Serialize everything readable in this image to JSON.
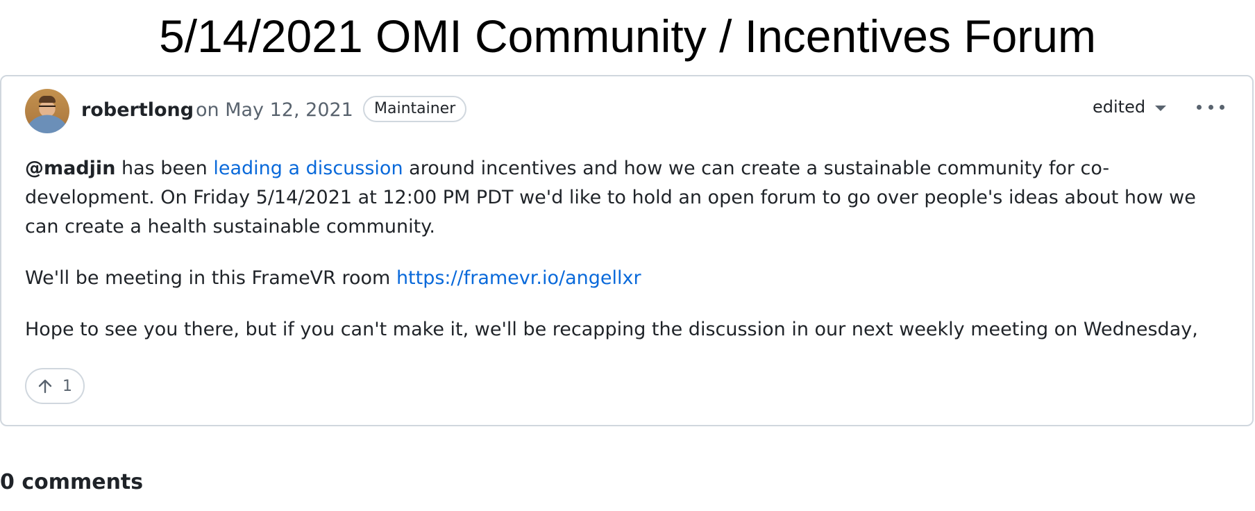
{
  "page": {
    "title": "5/14/2021 OMI Community / Incentives Forum"
  },
  "post": {
    "author": "robertlong",
    "date": "on May 12, 2021",
    "role_badge": "Maintainer",
    "edited_label": "edited",
    "more_icon": "kebab-horizontal-icon",
    "paragraph1": {
      "mention": "@madjin",
      "text_before_link": " has been ",
      "link_text": "leading a discussion",
      "text_after_link": " around incentives and how we can create a sustainable community for co-development. On Friday 5/14/2021 at 12:00 PM PDT we'd like to hold an open forum to go over people's ideas about how we can create a health sustainable community."
    },
    "paragraph2": {
      "text": "We'll be meeting in this FrameVR room ",
      "link_text": "https://framevr.io/angellxr"
    },
    "paragraph3": {
      "text": "Hope to see you there, but if you can't make it, we'll be recapping the discussion in our next weekly meeting on Wednesday,"
    },
    "upvote": {
      "icon": "arrow-up-icon",
      "count": "1"
    }
  },
  "comments": {
    "count_label": "0 comments"
  },
  "colors": {
    "link": "#0969da",
    "border": "#d0d7de",
    "muted": "#59636e",
    "text": "#1f2328"
  }
}
